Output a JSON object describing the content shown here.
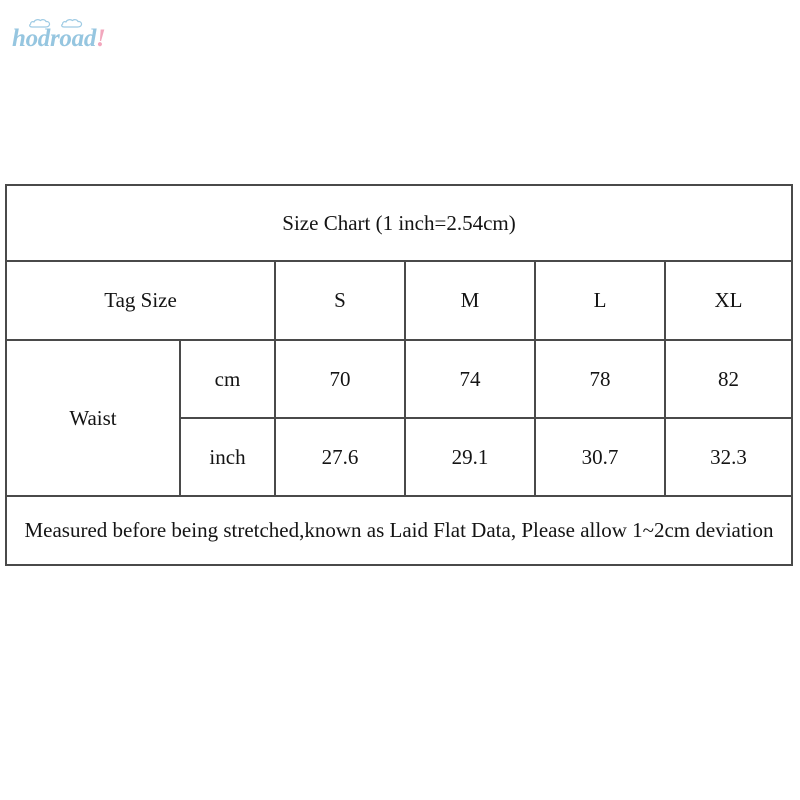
{
  "brand": {
    "name": "hodroad",
    "exclamation": "!",
    "text_color": "#96c6e0",
    "accent_color": "#f2a7bd",
    "cloud_icon": "cloud-icon"
  },
  "chart_data": {
    "type": "table",
    "title": "Size Chart (1 inch=2.54cm)",
    "row_header_label": "Tag Size",
    "measurement_label": "Waist",
    "categories": [
      "S",
      "M",
      "L",
      "XL"
    ],
    "units": [
      "cm",
      "inch"
    ],
    "series": [
      {
        "name": "cm",
        "values": [
          70,
          74,
          78,
          82
        ]
      },
      {
        "name": "inch",
        "values": [
          27.6,
          29.1,
          30.7,
          32.3
        ]
      }
    ],
    "note": "Measured before being stretched,known as Laid Flat Data, Please allow 1~2cm deviation",
    "border_color": "#4a4a4a",
    "text_color": "#141414",
    "background": "#ffffff"
  },
  "table": {
    "title": "Size Chart (1 inch=2.54cm)",
    "tag_size_label": "Tag Size",
    "sizes": {
      "s": "S",
      "m": "M",
      "l": "L",
      "xl": "XL"
    },
    "waist_label": "Waist",
    "cm_label": "cm",
    "inch_label": "inch",
    "cm_values": {
      "s": "70",
      "m": "74",
      "l": "78",
      "xl": "82"
    },
    "inch_values": {
      "s": "27.6",
      "m": "29.1",
      "l": "30.7",
      "xl": "32.3"
    },
    "note": "Measured before being stretched,known as Laid Flat Data, Please allow 1~2cm deviation"
  }
}
